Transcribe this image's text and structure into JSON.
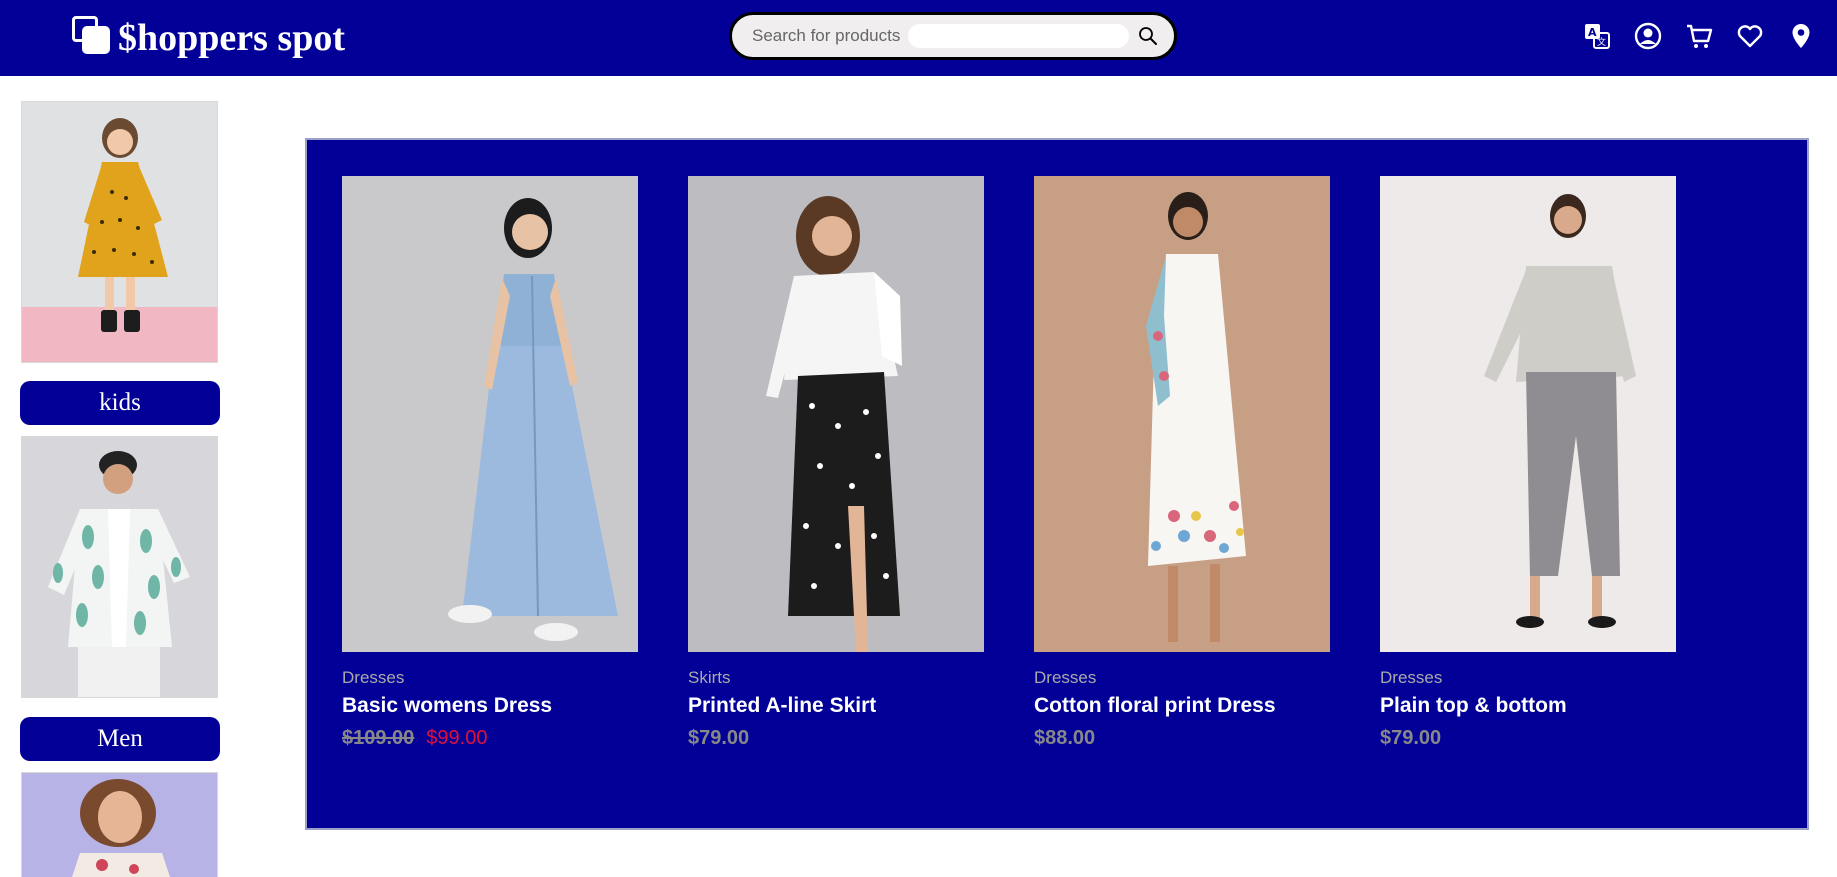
{
  "brand": {
    "name": "$hoppers spot"
  },
  "search": {
    "placeholder": "Search for products"
  },
  "header_icons": [
    "translate-icon",
    "account-icon",
    "cart-icon",
    "wishlist-icon",
    "location-icon"
  ],
  "colors": {
    "primary": "#020096",
    "sale": "#e0103c",
    "muted": "#888888"
  },
  "sidebar": {
    "categories": [
      {
        "label": "kids",
        "image": "girl-yellow-polka-dress"
      },
      {
        "label": "Men",
        "image": "man-tropical-shirt"
      },
      {
        "label": "",
        "image": "woman-floral-top"
      }
    ]
  },
  "products": [
    {
      "category": "Dresses",
      "name": "Basic womens Dress",
      "old_price": "$109.00",
      "price": "$99.00",
      "on_sale": true
    },
    {
      "category": "Skirts",
      "name": "Printed A-line Skirt",
      "price": "$79.00",
      "on_sale": false
    },
    {
      "category": "Dresses",
      "name": "Cotton floral print Dress",
      "price": "$88.00",
      "on_sale": false
    },
    {
      "category": "Dresses",
      "name": "Plain top & bottom",
      "price": "$79.00",
      "on_sale": false
    }
  ]
}
